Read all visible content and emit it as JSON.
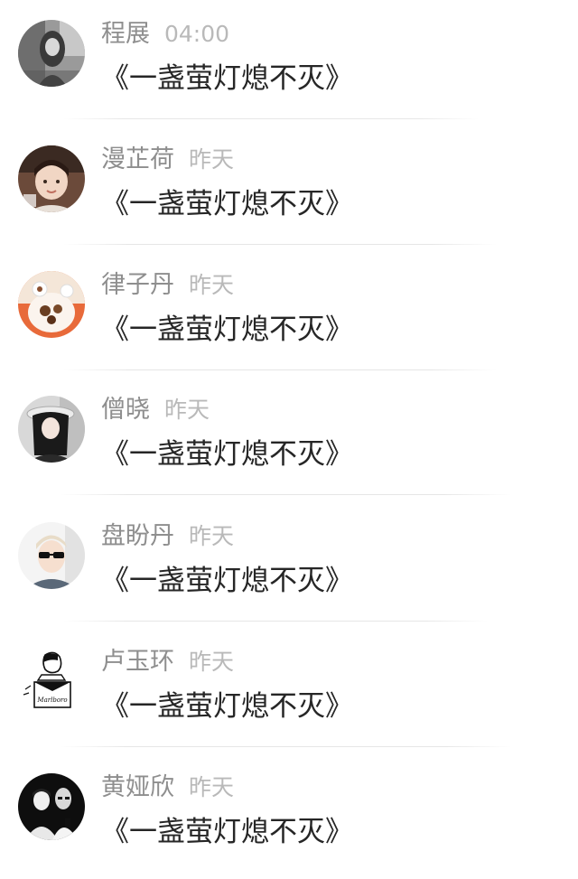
{
  "comments": [
    {
      "name": "程展",
      "time": "04:00",
      "text": "《一盏萤灯熄不灭》",
      "avatar_icon": "avatar-girl-bw-icon"
    },
    {
      "name": "漫芷荷",
      "time": "昨天",
      "text": "《一盏萤灯熄不灭》",
      "avatar_icon": "avatar-boy-icon"
    },
    {
      "name": "律子丹",
      "time": "昨天",
      "text": "《一盏萤灯熄不灭》",
      "avatar_icon": "avatar-cookies-icon"
    },
    {
      "name": "僧晓",
      "time": "昨天",
      "text": "《一盏萤灯熄不灭》",
      "avatar_icon": "avatar-girl-hat-icon"
    },
    {
      "name": "盘盼丹",
      "time": "昨天",
      "text": "《一盏萤灯熄不灭》",
      "avatar_icon": "avatar-sunglasses-icon"
    },
    {
      "name": "卢玉环",
      "time": "昨天",
      "text": "《一盏萤灯熄不灭》",
      "avatar_icon": "avatar-sketch-marlboro-icon",
      "avatar_lettering": "Marlboro"
    },
    {
      "name": "黄娅欣",
      "time": "昨天",
      "text": "《一盏萤灯熄不灭》",
      "avatar_icon": "avatar-two-people-bw-icon"
    }
  ],
  "colors": {
    "name": "#8e8e8e",
    "time": "#b9b9b9",
    "text": "#262626",
    "divider": "#e6e6e6",
    "background": "#ffffff"
  }
}
